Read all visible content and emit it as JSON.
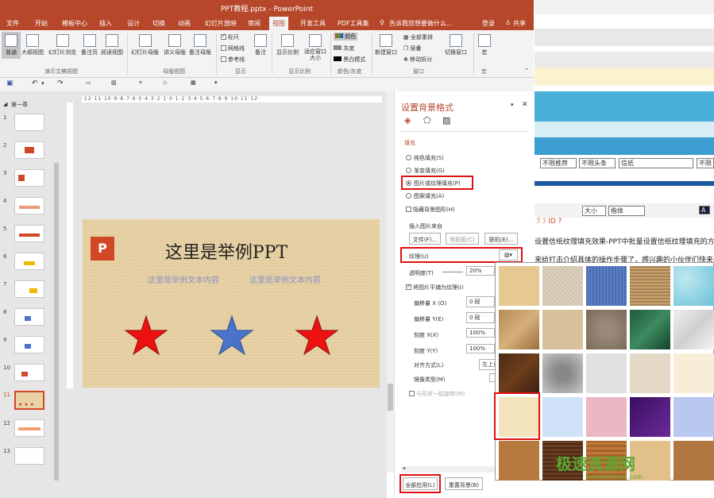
{
  "window": {
    "title": "PPT教程.pptx - PowerPoint",
    "login": "登录",
    "share": "共享"
  },
  "tabs": [
    "文件",
    "开始",
    "模板中心",
    "插入",
    "设计",
    "切换",
    "动画",
    "幻灯片放映",
    "审阅",
    "视图",
    "开发工具",
    "PDF工具集"
  ],
  "tell_me": "告诉我您想要做什么...",
  "ribbon": {
    "buttons": [
      "普通",
      "大纲视图",
      "幻灯片浏览",
      "备注页",
      "阅读视图",
      "幻灯片母版",
      "讲义母版",
      "备注母版",
      "备注",
      "显示比例",
      "适应窗口大小",
      "新建窗口",
      "切换窗口",
      "宏"
    ],
    "checkboxes": [
      "标尺",
      "网格线",
      "参考线"
    ],
    "color_options": [
      "颜色",
      "灰度",
      "黑白模式"
    ],
    "window_options": [
      "全部重排",
      "层叠",
      "移动拆分"
    ],
    "groups": [
      "演示文稿视图",
      "母版视图",
      "显示",
      "显示比例",
      "颜色/灰度",
      "窗口",
      "宏"
    ]
  },
  "thumbs": {
    "section": "第一章",
    "numbers": [
      "1",
      "2",
      "3",
      "4",
      "5",
      "6",
      "7",
      "8",
      "9",
      "10",
      "11",
      "12",
      "13"
    ]
  },
  "slide": {
    "logo": "P",
    "title": "这里是举例PPT",
    "subtitle_left": "这里是举例文本内容",
    "subtitle_right": "这里是举例文本内容"
  },
  "pane": {
    "title": "设置背景格式",
    "section_fill": "填充",
    "radios": [
      "纯色填充(S)",
      "渐变填充(G)",
      "图片或纹理填充(P)",
      "图案填充(A)"
    ],
    "hide_bg": "隐藏背景图形(H)",
    "insert_from": "插入图片来自",
    "btn_file": "文件(F)...",
    "btn_clip": "剪贴板(C)",
    "btn_online": "联机(E)...",
    "texture_label": "纹理(U)",
    "transparency_label": "透明度(T)",
    "transparency_value": "20%",
    "tile_label": "将图片平铺为纹理(I)",
    "offset_x_label": "偏移量 X (O)",
    "offset_x_value": "0 磅",
    "offset_y_label": "偏移量 Y(E)",
    "offset_y_value": "0 磅",
    "scale_x_label": "刻度 X(X)",
    "scale_x_value": "100%",
    "scale_y_label": "刻度 Y(Y)",
    "scale_y_value": "100%",
    "align_label": "对齐方式(L)",
    "align_value": "左上对",
    "mirror_label": "镜像类型(M)",
    "rotate_label": "与形状一起旋转(W)",
    "apply_all": "全部应用(L)",
    "reset": "重置背景(B)"
  },
  "web": {
    "filter1": "不限推荐",
    "filter2": "不限头条",
    "filter3": "信纸",
    "filter4": "不限",
    "font_size": "大小",
    "font_name": "楷体",
    "line1": "设置信纸纹理填充效果-PPT中批量设置信纸纹理填充的方法教",
    "line2": "来给打击介绍具体的操作步骤了，感兴趣的小伙伴们快来一起"
  },
  "watermark": {
    "name": "极速资源网",
    "url": "www.offices0.com"
  },
  "colors": {
    "accent": "#b7472a",
    "highlight": "#e01010",
    "star_red": "#ee1111",
    "star_blue": "#4a74c9"
  }
}
